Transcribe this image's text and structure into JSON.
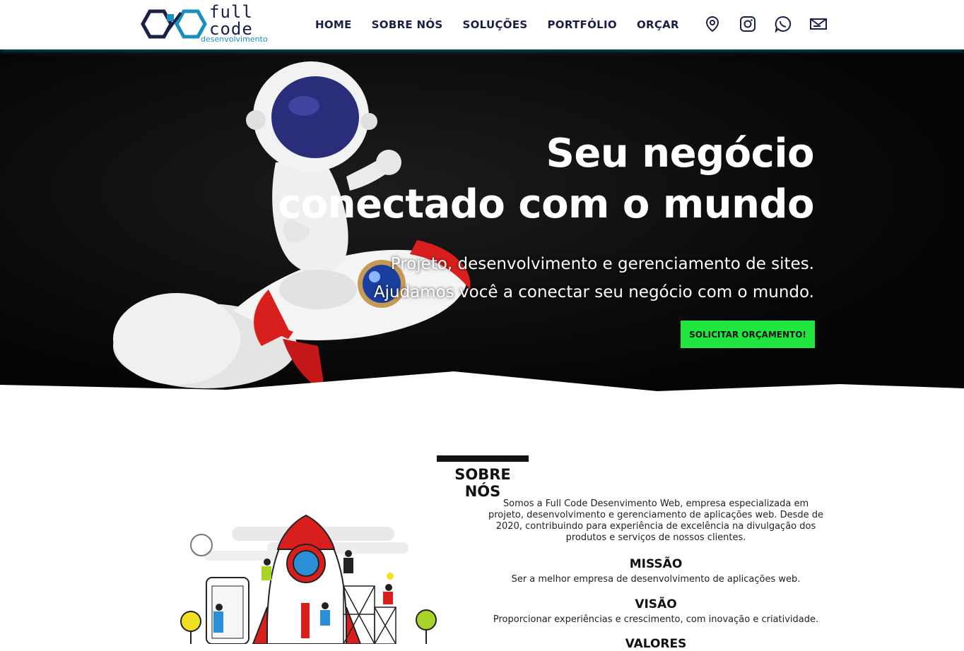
{
  "brand": {
    "logo_line1": "full",
    "logo_line2": "code",
    "logo_line3": "desenvolvimento"
  },
  "nav": {
    "items": [
      "HOME",
      "SOBRE NÓS",
      "SOLUÇÕES",
      "PORTFÓLIO",
      "ORÇAR"
    ]
  },
  "header_icons": [
    "map-pin-icon",
    "instagram-icon",
    "whatsapp-icon",
    "mail-icon"
  ],
  "hero": {
    "title_line1": "Seu negócio",
    "title_line2": "conectado com o mundo",
    "subtitle_line1": "Projeto, desenvolvimento e gerenciamento de sites.",
    "subtitle_line2": "Ajudamos você a conectar seu negócio com o mundo.",
    "cta_label": "SOLICITAR ORÇAMENTO!"
  },
  "about": {
    "title": "SOBRE NÓS",
    "text": "Somos a Full Code Desenvimento Web, empresa especializada em projeto, desenvolvimento e gerenciamento de aplicações web. Desde de 2020, contribuindo para experiência de excelência na divulgação dos produtos e serviços de nossos clientes.",
    "mission_title": "MISSÃO",
    "mission_text": "Ser a melhor empresa de desenvolvimento de aplicações web.",
    "vision_title": "VISÃO",
    "vision_text": "Proporcionar experiências e crescimento, com inovação e criatividade.",
    "values_title": "VALORES"
  },
  "colors": {
    "navy": "#1b1f4a",
    "brand_blue": "#1a8fbf",
    "cta_green": "#21e63d",
    "hero_bg": "#050505"
  }
}
